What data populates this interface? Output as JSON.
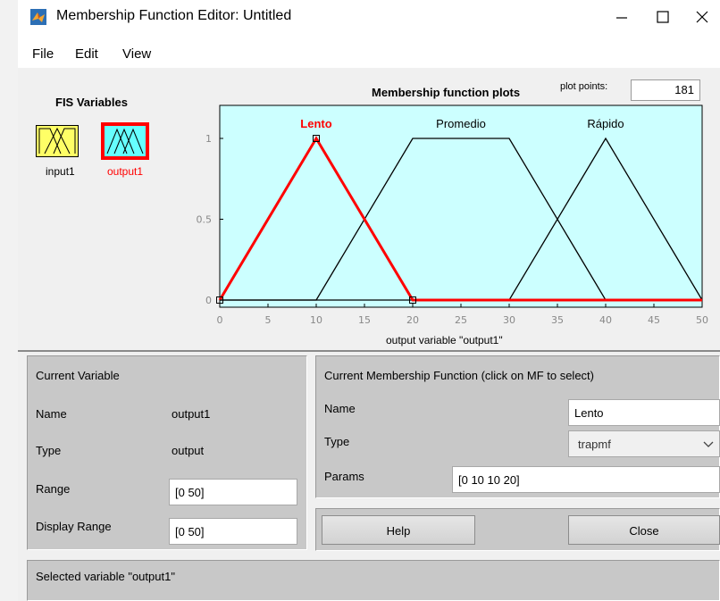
{
  "window": {
    "title": "Membership Function Editor: Untitled"
  },
  "menu": [
    "File",
    "Edit",
    "View"
  ],
  "fis_variables": {
    "heading": "FIS Variables",
    "items": [
      {
        "label": "input1",
        "color": "#000000",
        "box_fill": "#ffff66"
      },
      {
        "label": "output1",
        "color": "#ff0000",
        "box_fill": "#66ffff"
      }
    ]
  },
  "plot": {
    "title": "Membership function plots",
    "plot_points_label": "plot points:",
    "plot_points_value": "181",
    "xlabel": "output variable \"output1\"",
    "background": "#ccffff",
    "selected_color": "#ff0000"
  },
  "chart_data": {
    "type": "line",
    "title": "Membership function plots",
    "xlabel": "output variable \"output1\"",
    "ylabel": "",
    "xlim": [
      0,
      50
    ],
    "ylim": [
      0,
      1
    ],
    "x_ticks": [
      "0",
      "5",
      "10",
      "15",
      "20",
      "25",
      "30",
      "35",
      "40",
      "45",
      "50"
    ],
    "y_ticks": [
      "0",
      "0.5",
      "1"
    ],
    "series": [
      {
        "name": "Lento",
        "selected": true,
        "x": [
          0,
          10,
          10,
          20
        ],
        "y": [
          0,
          1,
          1,
          0
        ]
      },
      {
        "name": "Promedio",
        "selected": false,
        "x": [
          10,
          20,
          30,
          40
        ],
        "y": [
          0,
          1,
          1,
          0
        ]
      },
      {
        "name": "Rápido",
        "selected": false,
        "x": [
          30,
          40,
          50
        ],
        "y": [
          0,
          1,
          0
        ]
      }
    ]
  },
  "current_variable": {
    "heading": "Current Variable",
    "name_label": "Name",
    "name_value": "output1",
    "type_label": "Type",
    "type_value": "output",
    "range_label": "Range",
    "range_value": "[0 50]",
    "display_range_label": "Display Range",
    "display_range_value": "[0 50]"
  },
  "current_mf": {
    "heading": "Current Membership Function (click on MF to select)",
    "name_label": "Name",
    "name_value": "Lento",
    "type_label": "Type",
    "type_value": "trapmf",
    "params_label": "Params",
    "params_value": "[0 10 10 20]"
  },
  "buttons": {
    "help": "Help",
    "close": "Close"
  },
  "status": "Selected variable \"output1\""
}
